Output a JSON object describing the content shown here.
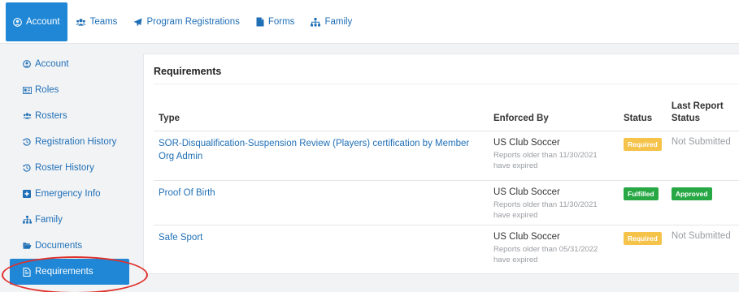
{
  "topnav": {
    "tabs": [
      {
        "label": "Account",
        "icon": "user-circle-icon",
        "active": true
      },
      {
        "label": "Teams",
        "icon": "users-icon",
        "active": false
      },
      {
        "label": "Program Registrations",
        "icon": "paper-plane-icon",
        "active": false
      },
      {
        "label": "Forms",
        "icon": "file-icon",
        "active": false
      },
      {
        "label": "Family",
        "icon": "sitemap-icon",
        "active": false
      }
    ]
  },
  "sidebar": {
    "items": [
      {
        "label": "Account",
        "icon": "user-circle-icon"
      },
      {
        "label": "Roles",
        "icon": "id-card-icon"
      },
      {
        "label": "Rosters",
        "icon": "users-icon"
      },
      {
        "label": "Registration History",
        "icon": "history-icon"
      },
      {
        "label": "Roster History",
        "icon": "history-icon"
      },
      {
        "label": "Emergency Info",
        "icon": "plus-square-icon"
      },
      {
        "label": "Family",
        "icon": "sitemap-icon"
      },
      {
        "label": "Documents",
        "icon": "folder-open-icon"
      },
      {
        "label": "Requirements",
        "icon": "file-text-icon",
        "active": true
      }
    ]
  },
  "requirements": {
    "title": "Requirements",
    "columns": {
      "type": "Type",
      "enforced_by": "Enforced By",
      "status": "Status",
      "last_report_line1": "Last Report",
      "last_report_line2": "Status"
    },
    "rows": [
      {
        "type": "SOR-Disqualification-Suspension Review (Players) certification by Member Org Admin",
        "enforced_by": "US Club Soccer",
        "note": "Reports older than 11/30/2021 have expired",
        "status": "Required",
        "last_report": "Not Submitted"
      },
      {
        "type": "Proof Of Birth",
        "enforced_by": "US Club Soccer",
        "note": "Reports older than 11/30/2021 have expired",
        "status": "Fulfilled",
        "last_report": "Approved"
      },
      {
        "type": "Safe Sport",
        "enforced_by": "US Club Soccer",
        "note": "Reports older than 05/31/2022 have expired",
        "status": "Required",
        "last_report": "Not Submitted"
      }
    ]
  },
  "colors": {
    "accent": "#1f87d6",
    "link": "#1f6fb6",
    "required_badge": "#f5c24a",
    "fulfilled_badge": "#27a844",
    "callout": "#e0302b"
  }
}
